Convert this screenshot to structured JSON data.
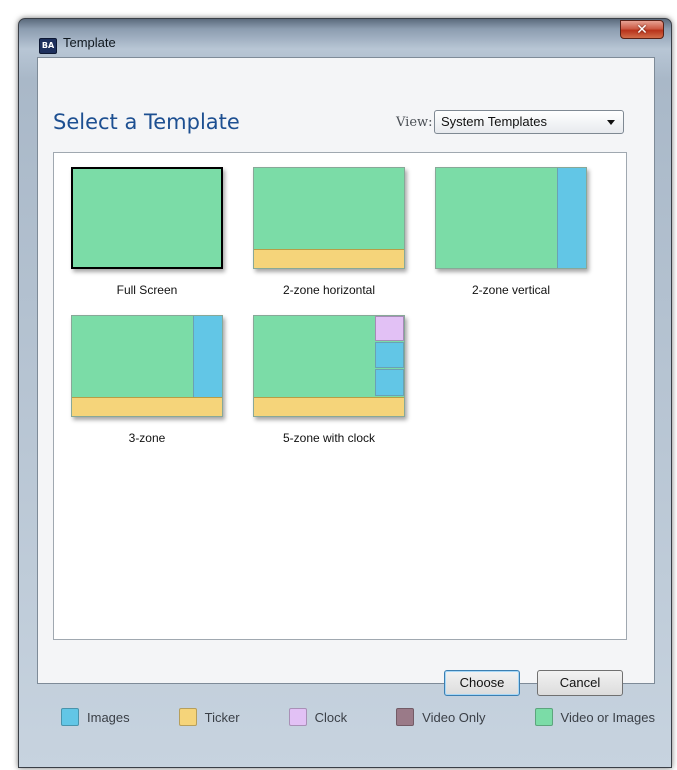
{
  "window": {
    "title": "Template",
    "icon_text": "BA"
  },
  "header": {
    "heading": "Select a Template",
    "view_label": "View:",
    "view_selected": "System Templates"
  },
  "templates": [
    {
      "label": "Full Screen",
      "selected": true
    },
    {
      "label": "2-zone horizontal",
      "selected": false
    },
    {
      "label": "2-zone vertical",
      "selected": false
    },
    {
      "label": "3-zone",
      "selected": false
    },
    {
      "label": "5-zone with clock",
      "selected": false
    }
  ],
  "buttons": {
    "choose": "Choose",
    "cancel": "Cancel"
  },
  "legend": [
    {
      "label": "Images",
      "color": "#62c6e6"
    },
    {
      "label": "Ticker",
      "color": "#f5d47a"
    },
    {
      "label": "Clock",
      "color": "#e2c1f5"
    },
    {
      "label": "Video Only",
      "color": "#9a7a88"
    },
    {
      "label": "Video or Images",
      "color": "#7bdca7"
    }
  ],
  "colors": {
    "video_or_images": "#7bdca7",
    "images": "#62c6e6",
    "ticker": "#f5d47a",
    "clock": "#e2c1f5",
    "heading": "#1d4f91"
  }
}
